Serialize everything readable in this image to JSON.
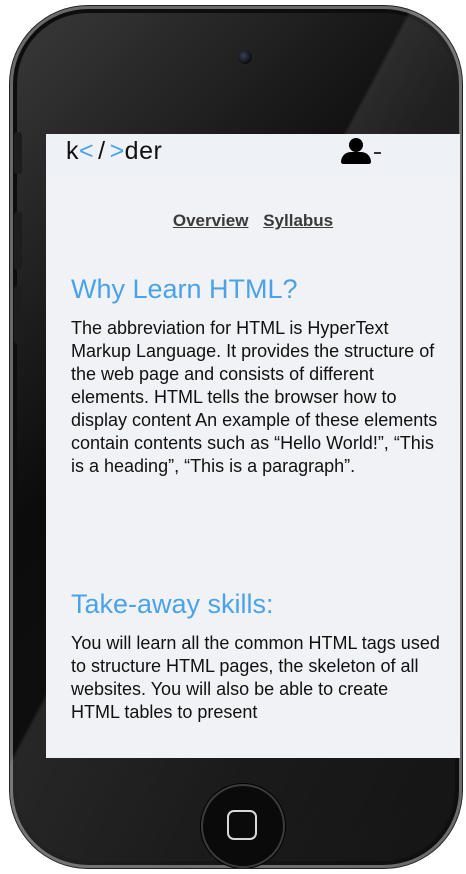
{
  "app": {
    "logo": {
      "k": "k",
      "lt": "<",
      "slash": "/",
      "gt": ">",
      "der": "der"
    },
    "user_icon": "user-icon",
    "menu_icon": "caret-down-icon"
  },
  "nav": {
    "tabs": [
      {
        "label": "Overview"
      },
      {
        "label": "Syllabus"
      }
    ]
  },
  "sections": [
    {
      "title": "Why Learn HTML?",
      "body": "The abbreviation for HTML is HyperText Markup Language. It provides the structure of the web page and consists of different elements. HTML tells the browser how to display content An example of these elements contain contents such as “Hello World!”, “This is a heading”, “This is a paragraph”."
    },
    {
      "title": "Take-away skills:",
      "body": "You will learn all the common HTML tags used to structure HTML pages, the skeleton of all websites. You will also be able to create HTML tables to present"
    }
  ],
  "colors": {
    "accent": "#4aa3e8",
    "header_bg": "#eef1f6",
    "content_bg": "#f1f2f5",
    "text": "#111111"
  }
}
